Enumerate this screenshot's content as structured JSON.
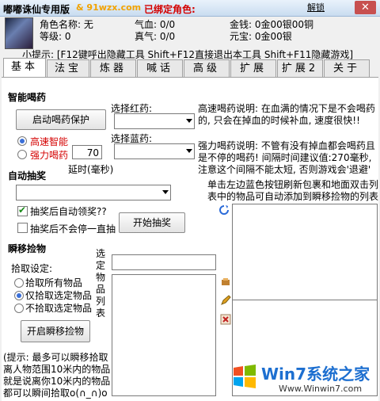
{
  "titlebar": {
    "title": "嘟嘟诛仙专用版",
    "url": "& 91wzx.com",
    "bound_label": "已绑定角色:",
    "unlock": "解锁",
    "close": "✕"
  },
  "info": {
    "name_label": "角色名称: 无",
    "level_label": "等级: 0",
    "qi_label": "气血: 0/0",
    "zhenqi_label": "真气: 0/0",
    "money_label": "金钱: 0金00银00铜",
    "yuanbao_label": "元宝: 0金00银",
    "hint": "小提示: [F12键呼出隐藏工具 Shift+F12直接退出本工具 Shift+F11隐藏游戏]"
  },
  "tabs": [
    {
      "label": "基本",
      "active": true
    },
    {
      "label": "法宝"
    },
    {
      "label": "炼器"
    },
    {
      "label": "喊话"
    },
    {
      "label": "高级"
    },
    {
      "label": "扩展"
    },
    {
      "label": "扩展2"
    },
    {
      "label": "关于"
    }
  ],
  "potion": {
    "section": "智能喝药",
    "start_button": "启动喝药保护",
    "red_select_label": "选择红药:",
    "blue_select_label": "选择蓝药:",
    "high_speed": "高速智能",
    "force": "强力喝药",
    "delay_value": "70",
    "delay_label": "延时(毫秒)",
    "desc_high": "高速喝药说明: 在血满的情况下是不会喝药的, 只会在掉血的时候补血, 速度很快!!",
    "desc_force": "强力喝药说明: 不管有没有掉血都会喝药且是不停的喝药! 间隔时间建议值:270毫秒, 注意这个间隔不能太短, 否则游戏会'退避'"
  },
  "lottery": {
    "section": "自动抽奖",
    "auto_claim": "抽奖后自动领奖??",
    "stay": "抽奖后不会停一直抽",
    "start_button": "开始抽奖"
  },
  "pickup": {
    "section": "瞬移捡物",
    "settings_label": "拾取设定:",
    "opt_all": "拾取所有物品",
    "opt_selected": "仅拾取选定物品",
    "opt_not_selected": "不拾取选定物品",
    "vertical_label": "选定物品列表",
    "start_button": "开启瞬移捡物",
    "note": "(提示: 最多可以瞬移拾取离人物范围10米内的物品就是说离你10米内的物品都可以瞬间拾取o(∩_∩)o"
  },
  "right_panel": {
    "desc": "单击左边蓝色按钮刷新包裹和地面双击列表中的物品可自动添加到瞬移捡物的列表"
  },
  "watermark": {
    "title": "Win7系统之家",
    "url": "Www.Winwin7.com"
  }
}
